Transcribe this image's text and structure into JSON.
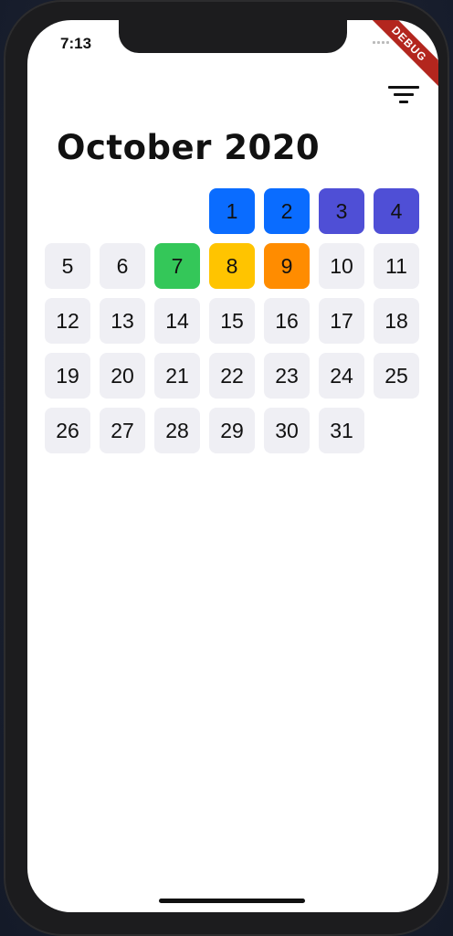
{
  "status": {
    "time": "7:13",
    "debug_label": "DEBUG"
  },
  "header": {
    "filter_icon": "filter-icon"
  },
  "calendar": {
    "title": "October 2020",
    "leading_blanks": 3,
    "days": [
      {
        "label": "1",
        "color": "#0a6cff"
      },
      {
        "label": "2",
        "color": "#0a6cff"
      },
      {
        "label": "3",
        "color": "#4f4fd6"
      },
      {
        "label": "4",
        "color": "#4f4fd6"
      },
      {
        "label": "5",
        "color": null
      },
      {
        "label": "6",
        "color": null
      },
      {
        "label": "7",
        "color": "#34c759"
      },
      {
        "label": "8",
        "color": "#ffc400"
      },
      {
        "label": "9",
        "color": "#ff8c00"
      },
      {
        "label": "10",
        "color": null
      },
      {
        "label": "11",
        "color": null
      },
      {
        "label": "12",
        "color": null
      },
      {
        "label": "13",
        "color": null
      },
      {
        "label": "14",
        "color": null
      },
      {
        "label": "15",
        "color": null
      },
      {
        "label": "16",
        "color": null
      },
      {
        "label": "17",
        "color": null
      },
      {
        "label": "18",
        "color": null
      },
      {
        "label": "19",
        "color": null
      },
      {
        "label": "20",
        "color": null
      },
      {
        "label": "21",
        "color": null
      },
      {
        "label": "22",
        "color": null
      },
      {
        "label": "23",
        "color": null
      },
      {
        "label": "24",
        "color": null
      },
      {
        "label": "25",
        "color": null
      },
      {
        "label": "26",
        "color": null
      },
      {
        "label": "27",
        "color": null
      },
      {
        "label": "28",
        "color": null
      },
      {
        "label": "29",
        "color": null
      },
      {
        "label": "30",
        "color": null
      },
      {
        "label": "31",
        "color": null
      }
    ]
  }
}
